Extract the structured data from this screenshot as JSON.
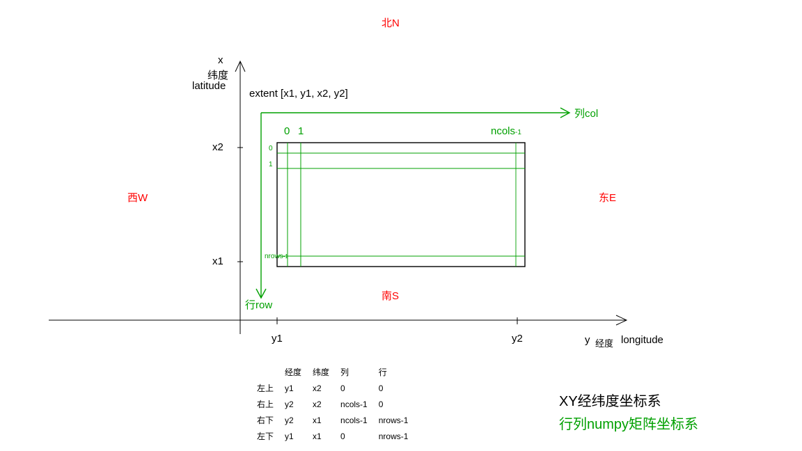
{
  "compass": {
    "north": "北N",
    "south": "南S",
    "east": "东E",
    "west": "西W"
  },
  "axis": {
    "x_letter": "x",
    "x_lat_cn": "纬度",
    "x_lat_en": "latitude",
    "y_letter": "y",
    "y_lng_cn": "经度",
    "y_lng_en": "longitude"
  },
  "ticks": {
    "x1": "x1",
    "x2": "x2",
    "y1": "y1",
    "y2": "y2"
  },
  "extent_label": "extent [x1, y1, x2, y2]",
  "grid": {
    "col_arrow": "列col",
    "row_arrow": "行row",
    "col0": "0",
    "col1": "1",
    "ncols": "ncols",
    "ncols_minus1": "-1",
    "row0": "0",
    "row1": "1",
    "nrows": "nrows",
    "nrows_minus1": "-1"
  },
  "legend": {
    "xy": "XY经纬度坐标系",
    "rc": "行列numpy矩阵坐标系"
  },
  "table": {
    "hdr_lng": "经度",
    "hdr_lat": "纬度",
    "hdr_col": "列",
    "hdr_row": "行",
    "rows": [
      {
        "label": "左上",
        "lng": "y1",
        "lat": "x2",
        "col": "0",
        "row": "0"
      },
      {
        "label": "右上",
        "lng": "y2",
        "lat": "x2",
        "col": "ncols-1",
        "row": "0"
      },
      {
        "label": "右下",
        "lng": "y2",
        "lat": "x1",
        "col": "ncols-1",
        "row": "nrows-1"
      },
      {
        "label": "左下",
        "lng": "y1",
        "lat": "x1",
        "col": "0",
        "row": "nrows-1"
      }
    ]
  }
}
